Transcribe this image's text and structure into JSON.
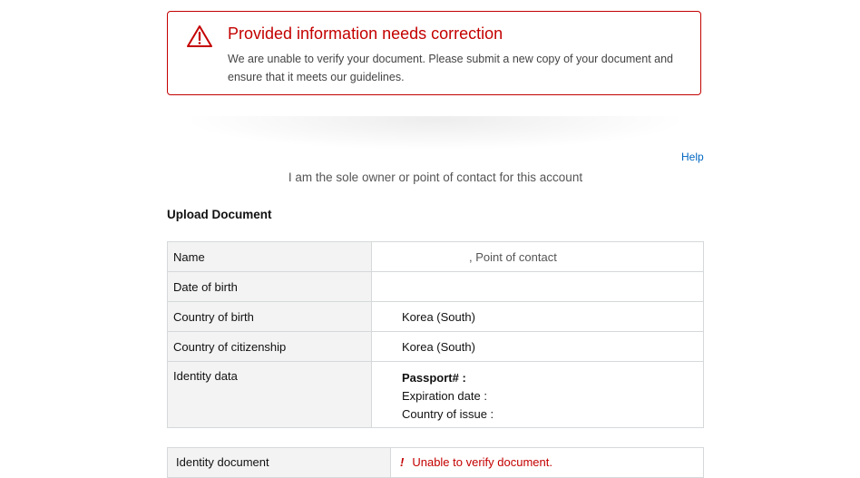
{
  "alert": {
    "title": "Provided information needs correction",
    "message": "We are unable to verify your document. Please submit a new copy of your document and ensure that it meets our guidelines.",
    "icon": "warning-triangle-icon",
    "color": "#c40000"
  },
  "help_link": "Help",
  "owner_statement": "I am the sole owner or point of contact for this account",
  "upload_section": {
    "heading": "Upload Document",
    "rows": [
      {
        "label": "Name",
        "value": ", Point of contact"
      },
      {
        "label": "Date of birth",
        "value": ""
      },
      {
        "label": "Country of birth",
        "value": "Korea (South)"
      },
      {
        "label": "Country of citizenship",
        "value": "Korea (South)"
      },
      {
        "label": "Identity data",
        "lines": [
          "Passport# :",
          "Expiration date :",
          "Country of issue :"
        ]
      }
    ]
  },
  "identity_document": {
    "label": "Identity document",
    "status_glyph": "!",
    "status": "Unable to verify document.",
    "status_color": "#c40000"
  }
}
